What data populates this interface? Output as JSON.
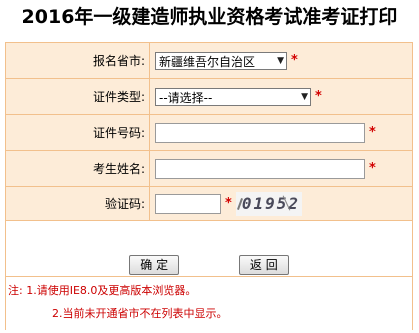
{
  "page": {
    "title": "2016年一级建造师执业资格考试准考证打印"
  },
  "form": {
    "province": {
      "label": "报名省市:",
      "selected": "新疆维吾尔自治区"
    },
    "id_type": {
      "label": "证件类型:",
      "selected": "--请选择--"
    },
    "id_number": {
      "label": "证件号码:",
      "value": ""
    },
    "name": {
      "label": "考生姓名:",
      "value": ""
    },
    "captcha": {
      "label": "验证码:",
      "value": "",
      "image_text": "01952"
    },
    "required_mark": "*"
  },
  "buttons": {
    "confirm_label": "确 定",
    "back_label": "返 回"
  },
  "notes": {
    "line1": "注: 1.请使用IE8.0及更高版本浏览器。",
    "line2": "2.当前未开通省市不在列表中显示。"
  },
  "icons": {
    "dropdown": "dropdown-arrow-icon"
  },
  "colors": {
    "cell_background": "#fdecd8",
    "cell_border": "#f2c08c",
    "required": "#d20000",
    "note_text": "#cc0000"
  }
}
